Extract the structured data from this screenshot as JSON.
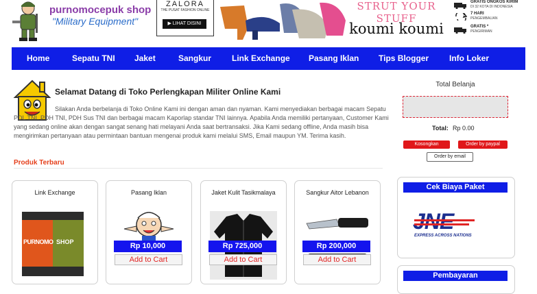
{
  "header": {
    "brand_title": "purnomocepuk shop",
    "brand_subtitle": "\"Military Equipment\"",
    "banner": {
      "zalora_logo": "ZALORA",
      "zalora_tagline": "THE PUSAT FASHION ONLINE",
      "zalora_button": "▶ LIHAT DISINI",
      "koumi_tagline": "STRUT YOUR STUFF",
      "koumi_name": "koumi koumi"
    },
    "features": [
      {
        "label": "GRATIS ONGKOS KIRIM",
        "sub": "DI 32 KOTA DI INDONESIA"
      },
      {
        "label": "7 HARI",
        "sub": "PENGEMBALIAN"
      },
      {
        "label": "GRATIS *",
        "sub": "PENGIRIMAN"
      }
    ]
  },
  "nav": {
    "items": [
      {
        "label": "Home"
      },
      {
        "label": "Sepatu TNI"
      },
      {
        "label": "Jaket"
      },
      {
        "label": "Sangkur"
      },
      {
        "label": "Link Exchange"
      },
      {
        "label": "Pasang Iklan"
      },
      {
        "label": "Tips Blogger"
      },
      {
        "label": "Info Loker"
      }
    ]
  },
  "welcome": {
    "title": "Selamat Datang di Toko Perlengkapan Militer Online Kami",
    "text": "Silakan Anda berbelanja di Toko Online Kami ini dengan aman dan nyaman. Kami menyediakan berbagai macam Sepatu PDL TNI, PDH TNI, PDH Sus TNI dan berbagai macam Kaporlap standar TNI lainnya. Apabila Anda memiliki pertanyaan, Customer Kami yang sedang online akan dengan sangat senang hati melayani Anda saat bertransaksi. Jika Kami sedang offline, Anda masih bisa mengirimkan pertanyaan atau permintaan bantuan mengenai produk kami melalui SMS, Email maupun YM. Terima kasih."
  },
  "products": {
    "heading": "Produk Terbaru",
    "items": [
      {
        "title": "Link Exchange",
        "logo_left": "PURNOMO",
        "logo_right": "SHOP",
        "price": "",
        "add_label": ""
      },
      {
        "title": "Pasang Iklan",
        "price": "Rp 10,000",
        "add_label": "Add to Cart"
      },
      {
        "title": "Jaket Kulit Tasikmalaya",
        "price": "Rp 725,000",
        "add_label": "Add to Cart"
      },
      {
        "title": "Sangkur Aitor Lebanon",
        "price": "Rp 200,000",
        "add_label": "Add to Cart"
      }
    ]
  },
  "sidebar": {
    "cart": {
      "title": "Total Belanja",
      "total_label": "Total:",
      "total_value": "Rp 0.00",
      "clear_button": "Kosongkan",
      "paypal_button": "Order by paypal",
      "email_button": "Order by email"
    },
    "shipping": {
      "heading": "Cek Biaya Paket",
      "logo_text": "JNE",
      "logo_tagline": "EXPRESS ACROSS NATIONS"
    },
    "payment": {
      "heading": "Pembayaran"
    }
  },
  "colors": {
    "nav_bg": "#0f1ee6",
    "heading_red": "#e53f1b",
    "brand_purple": "#8a3ca8",
    "price_blue": "#1414ee",
    "cart_red": "#e0171a"
  }
}
